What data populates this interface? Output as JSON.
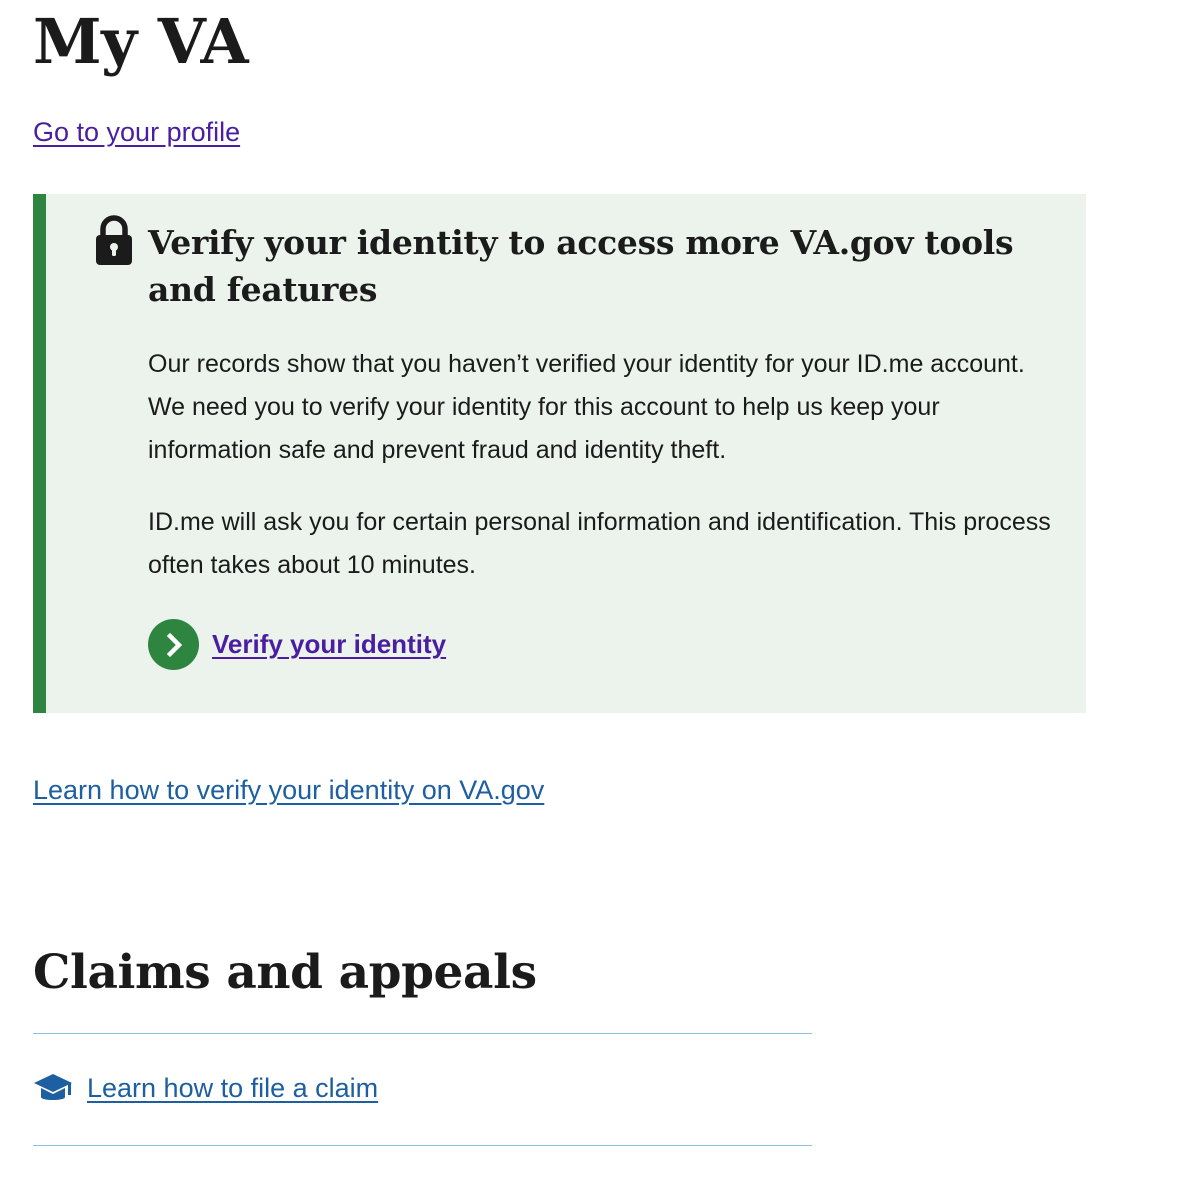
{
  "page": {
    "title": "My VA",
    "profile_link": "Go to your profile"
  },
  "alert": {
    "icon": "lock-icon",
    "heading": "Verify your identity to access more VA.gov tools and features",
    "paragraphs": [
      "Our records show that you haven’t verified your identity for your ID.me account. We need you to verify your identity for this account to help us keep your information safe and prevent fraud and identity theft.",
      "ID.me will ask you for certain personal information and identification. This process often takes about 10 minutes."
    ],
    "action_label": "Verify your identity",
    "action_icon": "chevron-right-icon"
  },
  "learn_verify_link": "Learn how to verify your identity on VA.gov",
  "claims_section": {
    "title": "Claims and appeals",
    "links": [
      {
        "icon": "graduation-cap-icon",
        "label": "Learn how to file a claim"
      }
    ]
  },
  "colors": {
    "alert_background": "#ecf3ec",
    "alert_border": "#2e8540",
    "visited_link": "#4a1ea0",
    "link": "#1d5fa0",
    "divider": "#89c2e0",
    "text": "#1b1b1b"
  }
}
